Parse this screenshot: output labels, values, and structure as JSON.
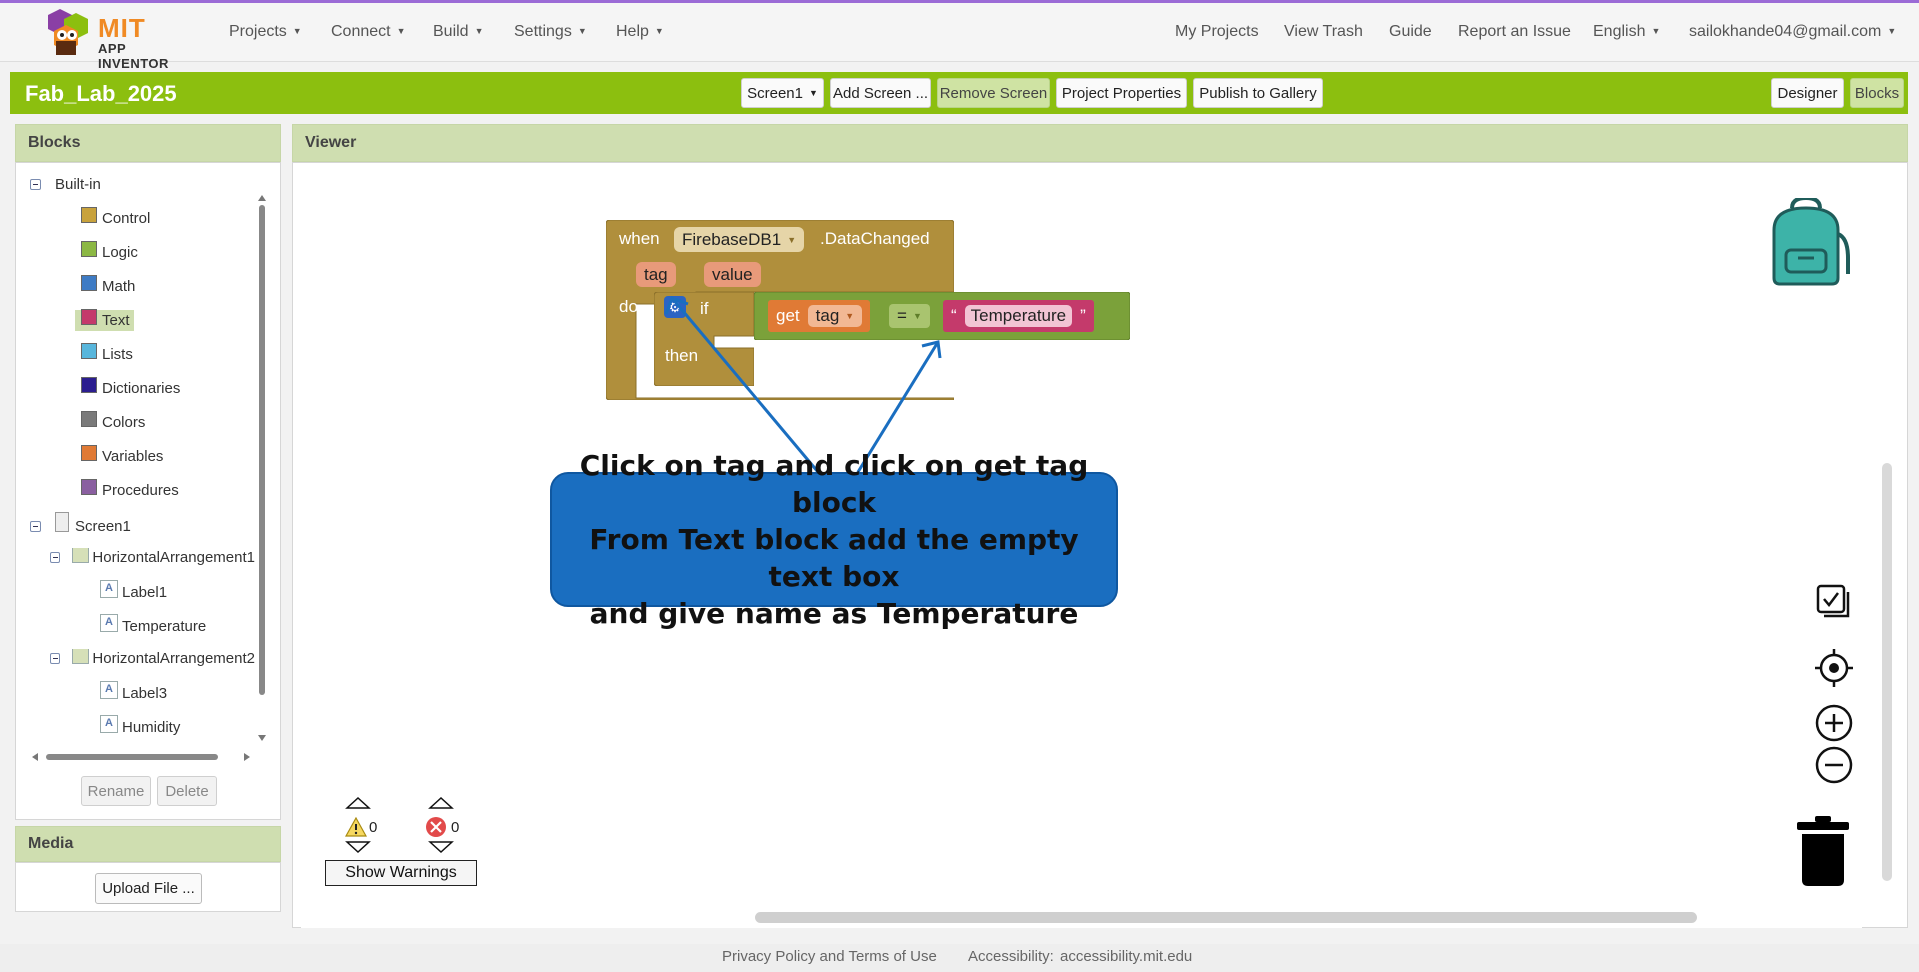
{
  "topnav": {
    "logo_line1": "MIT",
    "logo_line2": "APP INVENTOR",
    "menus": [
      "Projects",
      "Connect",
      "Build",
      "Settings",
      "Help"
    ],
    "right": {
      "my_projects": "My Projects",
      "view_trash": "View Trash",
      "guide": "Guide",
      "report": "Report an Issue",
      "language": "English",
      "account": "sailokhande04@gmail.com"
    }
  },
  "titlebar": {
    "project_name": "Fab_Lab_2025",
    "screen_select": "Screen1",
    "add_screen": "Add Screen ...",
    "remove_screen": "Remove Screen",
    "project_properties": "Project Properties",
    "publish": "Publish to Gallery",
    "designer": "Designer",
    "blocks": "Blocks"
  },
  "blocks_panel": {
    "title": "Blocks",
    "builtin": "Built-in",
    "categories": [
      {
        "label": "Control",
        "color": "#c8a23c"
      },
      {
        "label": "Logic",
        "color": "#8cb844"
      },
      {
        "label": "Math",
        "color": "#3e7bc4"
      },
      {
        "label": "Text",
        "color": "#c43a6b"
      },
      {
        "label": "Lists",
        "color": "#58b6dc"
      },
      {
        "label": "Dictionaries",
        "color": "#2b1d8f"
      },
      {
        "label": "Colors",
        "color": "#7a7a7a"
      },
      {
        "label": "Variables",
        "color": "#e07a35"
      },
      {
        "label": "Procedures",
        "color": "#8a5fa0"
      }
    ],
    "screen": "Screen1",
    "components": {
      "harr1": "HorizontalArrangement1",
      "label1": "Label1",
      "temperature": "Temperature",
      "harr2": "HorizontalArrangement2",
      "label3": "Label3",
      "humidity": "Humidity"
    },
    "rename": "Rename",
    "delete": "Delete"
  },
  "media_panel": {
    "title": "Media",
    "upload": "Upload File ..."
  },
  "viewer": {
    "title": "Viewer",
    "event_block": {
      "when": "when",
      "component": "FirebaseDB1",
      "event": ".DataChanged",
      "param1": "tag",
      "param2": "value",
      "do": "do"
    },
    "if_block": {
      "if": "if",
      "then": "then"
    },
    "compare_block": {
      "get": "get",
      "var": "tag",
      "op": "="
    },
    "text_block": {
      "open_quote": "“",
      "value": "Temperature",
      "close_quote": "”"
    },
    "callout": {
      "line1": "Click on tag and click on get tag block",
      "line2": "From Text block add the empty text box",
      "line3": "and give name as Temperature"
    },
    "warnings_count": "0",
    "errors_count": "0",
    "show_warnings": "Show Warnings"
  },
  "footer": {
    "privacy": "Privacy Policy and Terms of Use",
    "accessibility_label": "Accessibility:",
    "accessibility_link": "accessibility.mit.edu"
  }
}
